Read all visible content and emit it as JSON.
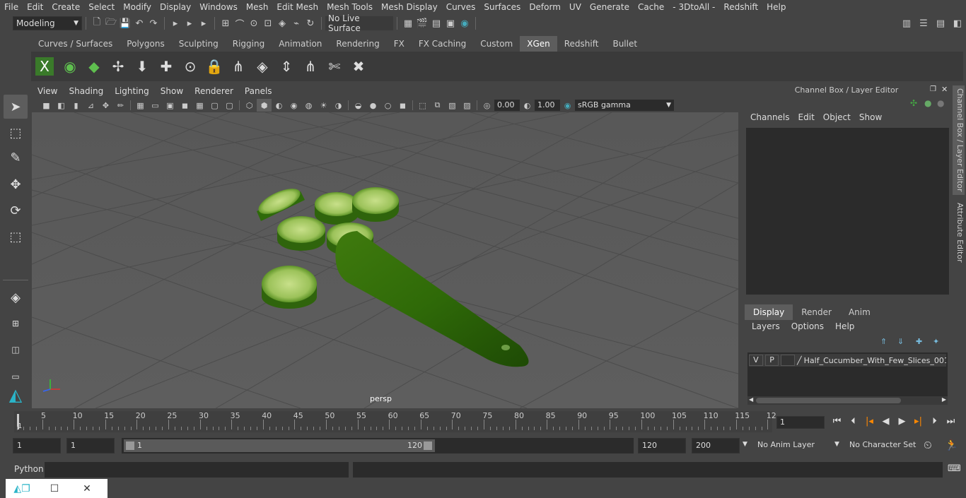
{
  "menubar": {
    "items": [
      "File",
      "Edit",
      "Create",
      "Select",
      "Modify",
      "Display",
      "Windows",
      "Mesh",
      "Edit Mesh",
      "Mesh Tools",
      "Mesh Display",
      "Curves",
      "Surfaces",
      "Deform",
      "UV",
      "Generate",
      "Cache",
      "- 3DtoAll -",
      "Redshift",
      "Help"
    ]
  },
  "statusline": {
    "mode": "Modeling",
    "live_surface": "No Live Surface"
  },
  "shelf": {
    "tabs": [
      "Curves / Surfaces",
      "Polygons",
      "Sculpting",
      "Rigging",
      "Animation",
      "Rendering",
      "FX",
      "FX Caching",
      "Custom",
      "XGen",
      "Redshift",
      "Bullet"
    ],
    "active_tab": "XGen",
    "icons": [
      "xgen-x-icon",
      "xgen-preview-icon",
      "xgen-leaf-icon",
      "add-guide-icon",
      "move-guide-icon",
      "guide-plus-icon",
      "guide-eye-icon",
      "guide-lock-icon",
      "guide-comb-icon",
      "grid-layer-icon",
      "guide-scale-icon",
      "guide-bend-icon",
      "guide-cut-icon",
      "guide-delete-icon"
    ]
  },
  "viewport": {
    "menu": [
      "View",
      "Shading",
      "Lighting",
      "Show",
      "Renderer",
      "Panels"
    ],
    "exposure": "0.00",
    "gamma": "1.00",
    "color_space": "sRGB gamma",
    "camera_label": "persp"
  },
  "channel_box": {
    "title": "Channel Box / Layer Editor",
    "menu": [
      "Channels",
      "Edit",
      "Object",
      "Show"
    ],
    "layer_tabs": [
      "Display",
      "Render",
      "Anim"
    ],
    "active_layer_tab": "Display",
    "layer_menu": [
      "Layers",
      "Options",
      "Help"
    ],
    "layers": [
      {
        "v": "V",
        "p": "P",
        "name": "Half_Cucumber_With_Few_Slices_001"
      }
    ]
  },
  "side_tabs": [
    "Channel Box / Layer Editor",
    "Attribute Editor"
  ],
  "timeline": {
    "ticks": [
      "5",
      "10",
      "15",
      "20",
      "25",
      "30",
      "35",
      "40",
      "45",
      "50",
      "55",
      "60",
      "65",
      "70",
      "75",
      "80",
      "85",
      "90",
      "95",
      "100",
      "105",
      "110",
      "115",
      "12"
    ],
    "start_marker": "1",
    "current_frame": "1"
  },
  "range": {
    "start": "1",
    "playback_start": "1",
    "slider_start": "1",
    "slider_end": "120",
    "playback_end": "120",
    "end": "200",
    "anim_layer": "No Anim Layer",
    "character_set": "No Character Set"
  },
  "cmdline": {
    "language": "Python"
  }
}
